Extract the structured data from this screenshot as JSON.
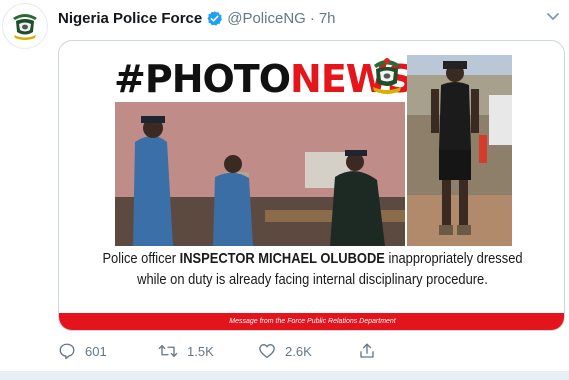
{
  "account": {
    "display_name": "Nigeria Police Force",
    "handle": "@PoliceNG",
    "separator": "·",
    "time": "7h"
  },
  "media": {
    "title_black": "#PHOTO",
    "title_red": "NEWS",
    "caption_line1_pre": "Police officer ",
    "caption_line1_bold": "INSPECTOR MICHAEL OLUBODE",
    "caption_line1_post": " inappropriately dressed",
    "caption_line2": "while on duty is already facing internal disciplinary procedure.",
    "footer": "Message from the Force Public Relations Department"
  },
  "actions": {
    "reply_count": "601",
    "retweet_count": "1.5K",
    "like_count": "2.6K"
  },
  "icons": {
    "verified": "verified-badge-icon",
    "caret": "chevron-down-icon",
    "reply": "reply-icon",
    "retweet": "retweet-icon",
    "like": "heart-icon",
    "share": "share-icon"
  },
  "colors": {
    "verified_blue": "#1da1f2",
    "news_red": "#e4161b",
    "muted": "#657786"
  }
}
